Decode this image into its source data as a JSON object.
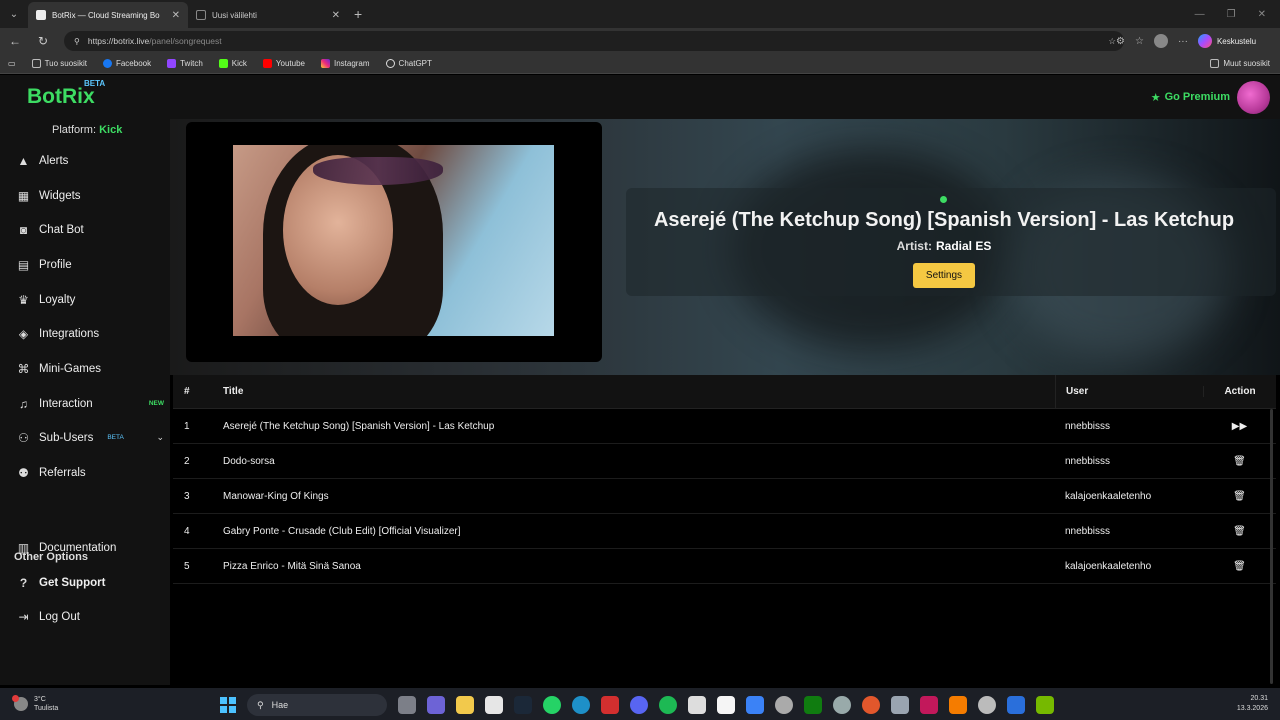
{
  "browser": {
    "tabs": [
      {
        "title": "BotRix — Cloud Streaming Bo",
        "active": true
      },
      {
        "title": "Uusi välilehti",
        "active": false
      }
    ],
    "url_host": "https://botrix.live",
    "url_path": "/panel/songrequest",
    "chat_label": "Keskustelu",
    "bookmarks": [
      "Tuo suosikit",
      "Facebook",
      "Twitch",
      "Kick",
      "Youtube",
      "Instagram",
      "ChatGPT"
    ],
    "other_bookmarks": "Muut suosikit"
  },
  "app": {
    "logo": "BotRix",
    "logo_badge": "BETA",
    "premium_label": "Go Premium",
    "accent_color": "#3ddc63"
  },
  "sidebar": {
    "platform_label": "Platform:",
    "platform_value": "Kick",
    "items": [
      {
        "label": "Alerts",
        "icon": "warning-icon"
      },
      {
        "label": "Widgets",
        "icon": "widgets-icon"
      },
      {
        "label": "Chat Bot",
        "icon": "robot-icon"
      },
      {
        "label": "Profile",
        "icon": "id-card-icon"
      },
      {
        "label": "Loyalty",
        "icon": "trophy-icon"
      },
      {
        "label": "Integrations",
        "icon": "cubes-icon"
      },
      {
        "label": "Mini-Games",
        "icon": "gamepad-icon"
      },
      {
        "label": "Interaction",
        "icon": "music-icon",
        "badge": "NEW"
      },
      {
        "label": "Sub-Users",
        "icon": "users-icon",
        "badge": "BETA"
      },
      {
        "label": "Referrals",
        "icon": "user-group-icon"
      }
    ],
    "other_options_title": "Other Options",
    "other_items": [
      {
        "label": "Documentation",
        "icon": "book-icon"
      },
      {
        "label": "Get Support",
        "icon": "question-icon"
      },
      {
        "label": "Log Out",
        "icon": "logout-icon"
      }
    ]
  },
  "now_playing": {
    "title": "Aserejé (The Ketchup Song) [Spanish Version] - Las Ketchup",
    "artist_label": "Artist:",
    "artist": "Radial ES",
    "settings_label": "Settings"
  },
  "queue": {
    "columns": [
      "#",
      "Title",
      "User",
      "Action"
    ],
    "rows": [
      {
        "num": "1",
        "title": "Aserejé (The Ketchup Song) [Spanish Version] - Las Ketchup",
        "user": "nnebbisss",
        "action": "skip-icon"
      },
      {
        "num": "2",
        "title": "Dodo-sorsa",
        "user": "nnebbisss",
        "action": "trash-icon"
      },
      {
        "num": "3",
        "title": "Manowar-King Of Kings",
        "user": "kalajoenkaaletenho",
        "action": "trash-icon"
      },
      {
        "num": "4",
        "title": "Gabry Ponte - Crusade (Club Edit) [Official Visualizer]",
        "user": "nnebbisss",
        "action": "trash-icon"
      },
      {
        "num": "5",
        "title": "Pizza Enrico - Mitä Sinä Sanoa",
        "user": "kalajoenkaaletenho",
        "action": "trash-icon"
      }
    ]
  },
  "taskbar": {
    "temperature": "3°C",
    "weather": "Tuulista",
    "search_placeholder": "Hae",
    "time": "20.31",
    "date": "13.3.2026"
  }
}
